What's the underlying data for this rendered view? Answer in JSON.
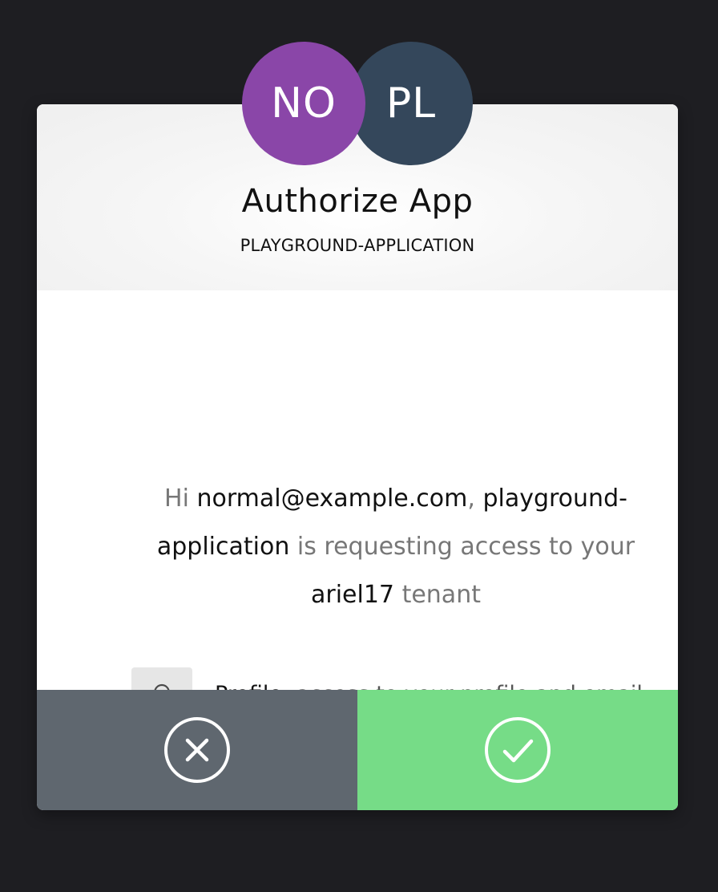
{
  "dialog": {
    "title": "Authorize App",
    "app_name": "PLAYGROUND-APPLICATION"
  },
  "avatars": {
    "user_initials": "NO",
    "app_initials": "PL",
    "user_color": "#8a46a8",
    "app_color": "#34475b"
  },
  "message": {
    "greeting": "Hi",
    "user_email": "normal@example.com",
    "comma": ",",
    "app_name": "playground-application",
    "requesting_text": "is requesting access to your",
    "tenant_name": "ariel17",
    "tenant_word": "tenant"
  },
  "permissions": [
    {
      "icon": "user-profile-icon",
      "label": "Profile:",
      "description": "access to your profile and email"
    }
  ],
  "actions": {
    "deny_icon": "close-circle-icon",
    "accept_icon": "check-circle-icon",
    "deny_color": "#5f676f",
    "accept_color": "#76dc87"
  }
}
